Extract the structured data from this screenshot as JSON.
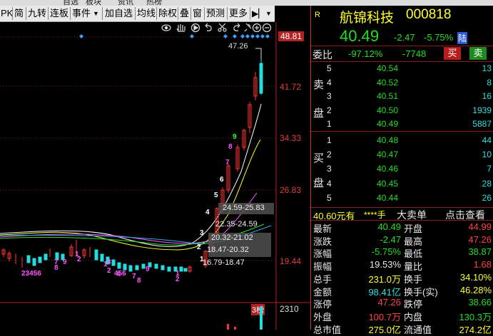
{
  "top_menu": [
    "自选",
    "板块",
    "资讯",
    "热榜"
  ],
  "toolbar": {
    "items": [
      "PK",
      "简",
      "九转",
      "连板",
      "事件",
      "加自选",
      "均线",
      "除权",
      "叠",
      "窗",
      "预测",
      "更多"
    ],
    "dropdown_icon": "triangle-down",
    "expand_icon": "double-arrow-right"
  },
  "chart_tools": [
    "eye",
    "hand",
    "play",
    "undo",
    "scissors",
    "redo",
    "pin",
    "zoom-in",
    "zoom-out"
  ],
  "price_axis": [
    "48.81",
    "41.72",
    "34.33",
    "26.83",
    "19.44"
  ],
  "volume_axis": [
    "2310"
  ],
  "annotations": {
    "high": "47.26",
    "band1": "24.59-25.83",
    "band2": "22.35-24.59",
    "band3": "20.32-21.02",
    "band4": "18.47-20.32",
    "band5": "16.79-18.47",
    "tag": "3榜"
  },
  "stock": {
    "flag": "R",
    "name": "航锦科技",
    "code": "000818",
    "price": "40.49",
    "change": "-2.47",
    "change_pct": "-5.75%",
    "market": "陆",
    "weibi_label": "委比",
    "weibi": "-97.12%",
    "weicha": "-7748",
    "buy_btn": "买",
    "sell_btn": "卖"
  },
  "order_book": {
    "sell_label": [
      "卖",
      "盘"
    ],
    "buy_label": [
      "买",
      "盘"
    ],
    "sell": [
      {
        "level": "5",
        "price": "40.54",
        "vol": "13"
      },
      {
        "level": "4",
        "price": "40.52",
        "vol": "8"
      },
      {
        "level": "3",
        "price": "40.51",
        "vol": "16"
      },
      {
        "level": "2",
        "price": "40.50",
        "vol": "1939"
      },
      {
        "level": "1",
        "price": "40.49",
        "vol": "5887"
      }
    ],
    "buy": [
      {
        "level": "1",
        "price": "40.48",
        "vol": "44"
      },
      {
        "level": "2",
        "price": "40.47",
        "vol": "10"
      },
      {
        "level": "3",
        "price": "40.46",
        "vol": "7"
      },
      {
        "level": "4",
        "price": "40.45",
        "vol": "28"
      },
      {
        "level": "5",
        "price": "40.44",
        "vol": "26"
      }
    ]
  },
  "big_order": {
    "price": "40.60元有",
    "hands": "****手",
    "label": "大卖单",
    "link": "点击查看"
  },
  "stats": [
    {
      "l1": "最新",
      "v1": "40.49",
      "c1": "grn",
      "l2": "开盘",
      "v2": "44.99",
      "c2": "red"
    },
    {
      "l1": "涨跌",
      "v1": "-2.47",
      "c1": "grn",
      "l2": "最高",
      "v2": "47.26",
      "c2": "red"
    },
    {
      "l1": "涨幅",
      "v1": "-5.75%",
      "c1": "grn",
      "l2": "最低",
      "v2": "38.87",
      "c2": "grn"
    },
    {
      "l1": "振幅",
      "v1": "19.53%",
      "c1": "wht",
      "l2": "量比",
      "v2": "1.68",
      "c2": "red"
    },
    {
      "l1": "总手",
      "v1": "231.0万",
      "c1": "yel",
      "l2": "换手",
      "v2": "34.10%",
      "c2": "yel"
    },
    {
      "l1": "金额",
      "v1": "98.41亿",
      "c1": "cyan",
      "l2": "换手(实)",
      "v2": "46.28%",
      "c2": "yel"
    },
    {
      "l1": "涨停",
      "v1": "47.26",
      "c1": "red",
      "l2": "跌停",
      "v2": "38.66",
      "c2": "grn"
    },
    {
      "l1": "外盘",
      "v1": "100.7万",
      "c1": "red",
      "l2": "内盘",
      "v2": "130.3万",
      "c2": "grn"
    },
    {
      "l1": "总市值",
      "v1": "275.0亿",
      "c1": "yel",
      "l2": "流通值",
      "v2": "274.2亿",
      "c2": "yel"
    }
  ],
  "colors": {
    "up": "#ff3333",
    "down": "#22dd22",
    "axis": "#b22222",
    "ma5": "#ffffff",
    "ma10": "#ffff33",
    "ma20": "#ff33ff",
    "ma60": "#33dd33"
  }
}
